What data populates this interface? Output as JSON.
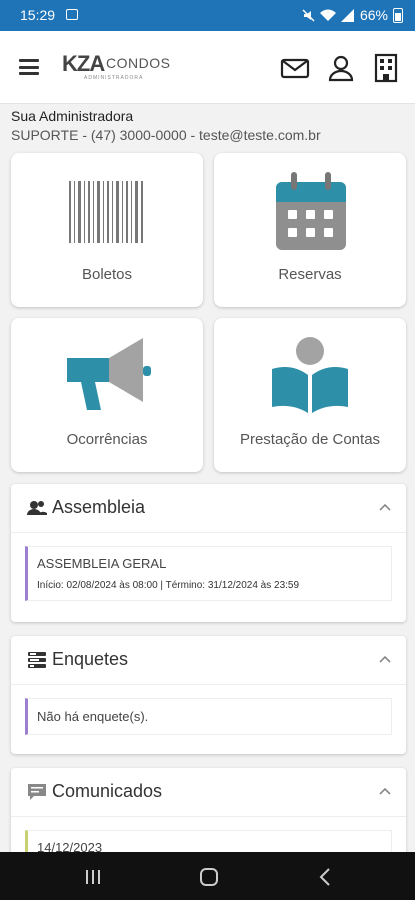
{
  "status": {
    "time": "15:29",
    "battery": "66%"
  },
  "brand": {
    "logo_main": "KZA",
    "logo_condos": "CONDOS",
    "logo_sub": "ADMINISTRADORA"
  },
  "administradora": {
    "label": "Sua Administradora",
    "contact": "SUPORTE - (47) 3000-0000 - teste@teste.com.br"
  },
  "tiles": [
    {
      "label": "Boletos",
      "icon": "barcode-icon"
    },
    {
      "label": "Reservas",
      "icon": "calendar-icon"
    },
    {
      "label": "Ocorrências",
      "icon": "megaphone-icon"
    },
    {
      "label": "Prestação de Contas",
      "icon": "reader-book-icon"
    }
  ],
  "assembleia": {
    "title": "Assembleia",
    "item_title": "ASSEMBLEIA GERAL",
    "item_dates": "Início: 02/08/2024 às 08:00 | Término: 31/12/2024 às 23:59"
  },
  "enquetes": {
    "title": "Enquetes",
    "empty": "Não há enquete(s)."
  },
  "comunicados": {
    "title": "Comunicados",
    "first_date": "14/12/2023"
  },
  "colors": {
    "statusbar": "#1f73b7",
    "accent_teal": "#2d8fa8",
    "entry_border": "#9c7fd0"
  }
}
